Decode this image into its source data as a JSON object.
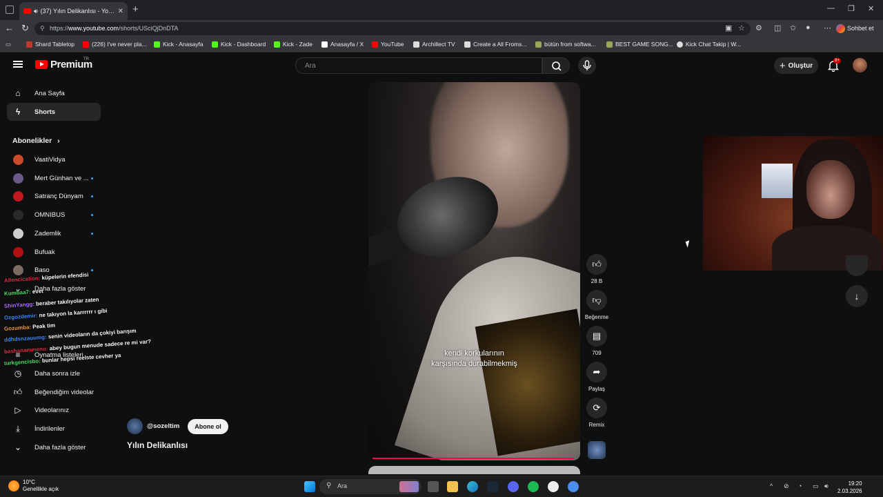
{
  "browser": {
    "tab_title": "(37) Yılın Delikanlısı - YouTube",
    "url_prefix": "https://",
    "url_domain": "www.youtube.com",
    "url_path": "/shorts/USciQjDnDTA",
    "chat_button": "Sohbet et",
    "bookmarks": [
      {
        "label": "Shard Tabletop",
        "color": "#c0392b"
      },
      {
        "label": "(226) I've never pla...",
        "color": "#ff0000"
      },
      {
        "label": "Kick - Anasayfa",
        "color": "#53fc18"
      },
      {
        "label": "Kick - Dashboard",
        "color": "#53fc18"
      },
      {
        "label": "Kick - Zade",
        "color": "#53fc18"
      },
      {
        "label": "Anasayfa / X",
        "color": "#ffffff"
      },
      {
        "label": "YouTube",
        "color": "#ff0000"
      },
      {
        "label": "Archillect TV",
        "color": "#dddddd"
      },
      {
        "label": "Create a All Froms...",
        "color": "#dddddd"
      },
      {
        "label": "bütün from softwa...",
        "color": "#9aa65a"
      },
      {
        "label": "BEST GAME SONG...",
        "color": "#9aa65a"
      },
      {
        "label": "Kick Chat Takip | W...",
        "color": "#dddddd"
      }
    ]
  },
  "header": {
    "logo_text": "Premium",
    "logo_sup": "TR",
    "search_placeholder": "Ara",
    "create_label": "Oluştur",
    "notif_badge": "9+"
  },
  "sidebar": {
    "home": "Ana Sayfa",
    "shorts": "Shorts",
    "subscriptions_title": "Abonelikler",
    "subscriptions": [
      {
        "label": "VaatiVidya",
        "color": "#c84a2a",
        "dot": false
      },
      {
        "label": "Mert Günhan ve ...",
        "color": "#6a5a8a",
        "dot": true
      },
      {
        "label": "Satranç Dünyam",
        "color": "#c0181c",
        "dot": true
      },
      {
        "label": "OMNIBUS",
        "color": "#2a2a2a",
        "dot": true
      },
      {
        "label": "Zademlik",
        "color": "#cfcfcf",
        "dot": true
      },
      {
        "label": "Bufuak",
        "color": "#b01010",
        "dot": false
      },
      {
        "label": "Baso",
        "color": "#7a6a62",
        "dot": true
      }
    ],
    "show_more_subs": "Daha fazla göster",
    "playlists_partial": "Oynatma listeleri",
    "watch_later": "Daha sonra izle",
    "liked_videos": "Beğendiğim videolar",
    "your_videos": "Videolarınız",
    "downloads": "İndirilenler",
    "show_more": "Daha fazla göster"
  },
  "chat_overlay": [
    {
      "user": "Allencication:",
      "user_color": "#e0304a",
      "msg": "küpelerin efendisi"
    },
    {
      "user": "Kumbaa7:",
      "user_color": "#49e060",
      "msg": "evet"
    },
    {
      "user": "ShinYangg:",
      "user_color": "#b070ff",
      "msg": "beraber takılıyolar zaten"
    },
    {
      "user": "Ozgozdemir:",
      "user_color": "#3f8cff",
      "msg": "ne takıyon la karrrrrr ı gibi"
    },
    {
      "user": "Gozumba:",
      "user_color": "#f0a040",
      "msg": "Peak tim"
    },
    {
      "user": "ddhdsnzauumg:",
      "user_color": "#3f8cff",
      "msg": "senin videoların da çokiyi barışım"
    },
    {
      "user": "bashanammeno:",
      "user_color": "#e0304a",
      "msg": "abey bugun menude sadece re mi var?"
    },
    {
      "user": "turkgencisbo:",
      "user_color": "#49e060",
      "msg": "bunlar hepsi reelste cevher ya"
    }
  ],
  "video": {
    "caption_line1": "kendi korkularının",
    "caption_line2": "karşısında durabilmekmiş",
    "channel_handle": "@sozeltim",
    "subscribe_label": "Abone ol",
    "title": "Yılın Delikanlısı",
    "progress": 0.99
  },
  "actions": {
    "likes": "28 B",
    "dislike_label": "Beğenme",
    "comments": "709",
    "share_label": "Paylaş",
    "remix_label": "Remix"
  },
  "taskbar": {
    "temp": "10°C",
    "weather": "Genellikle açık",
    "search": "Ara",
    "time": "19:20",
    "date": "2.03.2026"
  }
}
